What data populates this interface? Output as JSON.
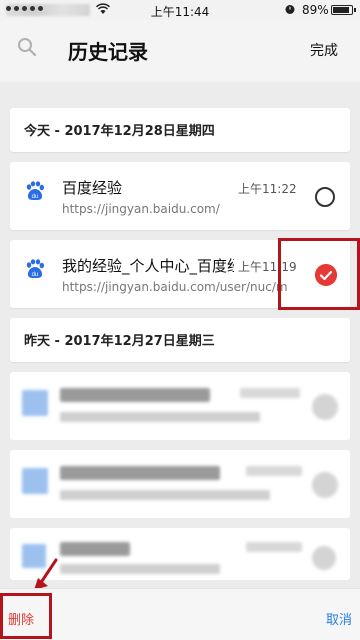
{
  "status_bar": {
    "time": "上午11:44",
    "battery": "89%",
    "battery_level": 0.89
  },
  "header": {
    "title": "历史记录",
    "done_label": "完成",
    "search_icon": "search-icon"
  },
  "groups": [
    {
      "date": "今天 - 2017年12月28日星期四",
      "items": [
        {
          "title": "百度经验",
          "url": "https://jingyan.baidu.com/",
          "time": "上午11:22",
          "selected": false,
          "icon": "baidu-paw-icon"
        },
        {
          "title": "我的经验_个人中心_百度经验",
          "url": "https://jingyan.baidu.com/user/nuc/m",
          "time": "上午11:19",
          "selected": true,
          "icon": "baidu-paw-icon"
        }
      ]
    },
    {
      "date": "昨天 - 2017年12月27日星期三",
      "items": []
    }
  ],
  "bottom_bar": {
    "delete_label": "删除",
    "cancel_label": "取消"
  },
  "colors": {
    "accent_red": "#e53935",
    "annotation_red": "#b4151c",
    "link_blue": "#2a7de1",
    "baidu_blue": "#2b6de5"
  }
}
